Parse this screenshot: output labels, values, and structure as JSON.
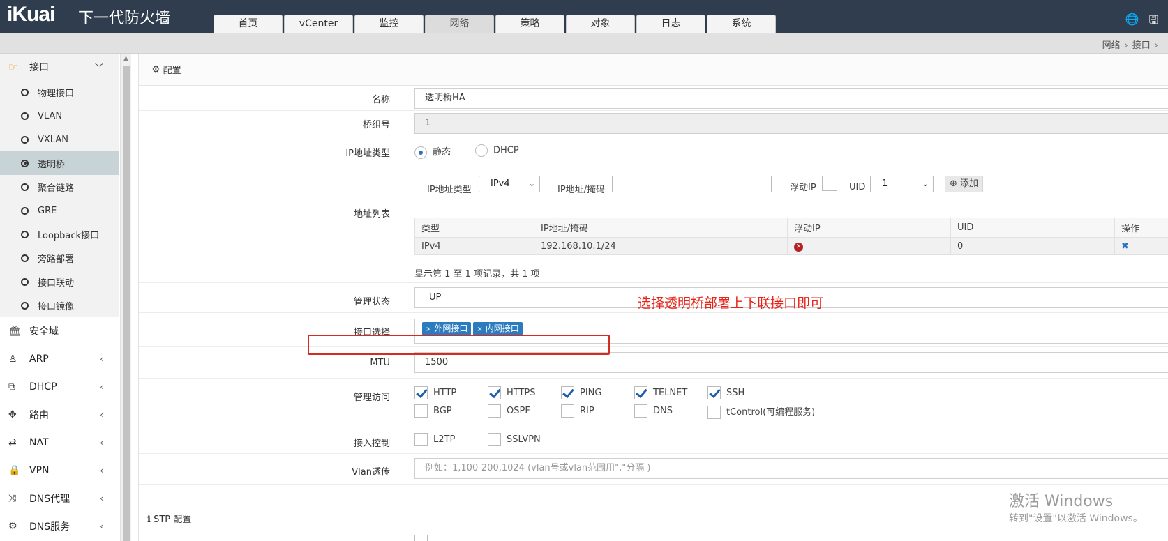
{
  "app": {
    "logo": "iKuai",
    "product": "下一代防火墙"
  },
  "tabs": [
    "首页",
    "vCenter",
    "监控",
    "网络",
    "策略",
    "对象",
    "日志",
    "系统"
  ],
  "active_tab": "网络",
  "breadcrumb": [
    "网络",
    "接口"
  ],
  "sidebar": {
    "group": "接口",
    "subitems": [
      "物理接口",
      "VLAN",
      "VXLAN",
      "透明桥",
      "聚合链路",
      "GRE",
      "Loopback接口",
      "旁路部署",
      "接口联动",
      "接口镜像"
    ],
    "active_subitem": "透明桥",
    "items": [
      "安全域",
      "ARP",
      "DHCP",
      "路由",
      "NAT",
      "VPN",
      "DNS代理",
      "DNS服务"
    ]
  },
  "panel": {
    "title": "配置"
  },
  "form": {
    "name_label": "名称",
    "name_value": "透明桥HA",
    "bridge_label": "桥组号",
    "bridge_value": "1",
    "iptype_label": "IP地址类型",
    "iptype_options": [
      "静态",
      "DHCP"
    ],
    "addr_label": "地址列表",
    "addr_bar": {
      "iptype_label": "IP地址类型",
      "iptype_value": "IPv4",
      "ipmask_label": "IP地址/掩码",
      "float_label": "浮动IP",
      "uid_label": "UID",
      "uid_value": "1",
      "add_label": "添加"
    },
    "addr_table": {
      "headers": [
        "类型",
        "IP地址/掩码",
        "浮动IP",
        "UID",
        "操作"
      ],
      "rows": [
        [
          "IPv4",
          "192.168.10.1/24",
          "",
          "0",
          ""
        ]
      ]
    },
    "addr_summary": "显示第 1 至 1 项记录，共 1 项",
    "admin_state_label": "管理状态",
    "admin_state_value": "UP",
    "iface_label": "接口选择",
    "iface_tags": [
      "外网接口",
      "内网接口"
    ],
    "mtu_label": "MTU",
    "mtu_value": "1500",
    "mgmt_label": "管理访问",
    "mgmt_checked": [
      "HTTP",
      "HTTPS",
      "PING",
      "TELNET",
      "SSH"
    ],
    "mgmt_unchecked": [
      "BGP",
      "OSPF",
      "RIP",
      "DNS",
      "tControl(可编程服务)"
    ],
    "access_label": "接入控制",
    "access_options": [
      "L2TP",
      "SSLVPN"
    ],
    "vlan_label": "Vlan透传",
    "vlan_placeholder": "例如：1,100-200,1024 (vlan号或vlan范围用\",\"分隔 )",
    "stp_title": "STP 配置"
  },
  "annotation": "选择透明桥部署上下联接口即可",
  "watermark": {
    "line1": "激活 Windows",
    "line2": "转到\"设置\"以激活 Windows。"
  },
  "colors": {
    "topbar": "#2f3d4f",
    "accent": "#2b7bbf",
    "annotation": "#e82318"
  }
}
